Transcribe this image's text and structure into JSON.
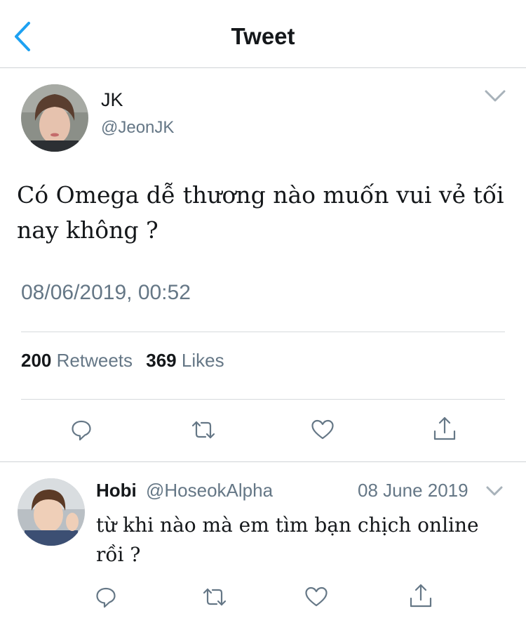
{
  "header": {
    "title": "Tweet",
    "back_icon": "chevron-left-icon"
  },
  "tweet": {
    "author_name": "JK",
    "author_handle": "@JeonJK",
    "text": "Có Omega dễ thương nào muốn vui vẻ tối nay không ?",
    "timestamp": "08/06/2019, 00:52",
    "retweets_count": "200",
    "retweets_label": "Retweets",
    "likes_count": "369",
    "likes_label": "Likes"
  },
  "reply": {
    "author_name": "Hobi",
    "author_handle": "@HoseokAlpha",
    "date": "08 June 2019",
    "text": "từ khi nào mà em tìm bạn chịch online rồi ?"
  },
  "colors": {
    "accent": "#1da1f2",
    "icon_gray": "#657786",
    "text": "#14171a",
    "divider": "#d6dadd"
  }
}
